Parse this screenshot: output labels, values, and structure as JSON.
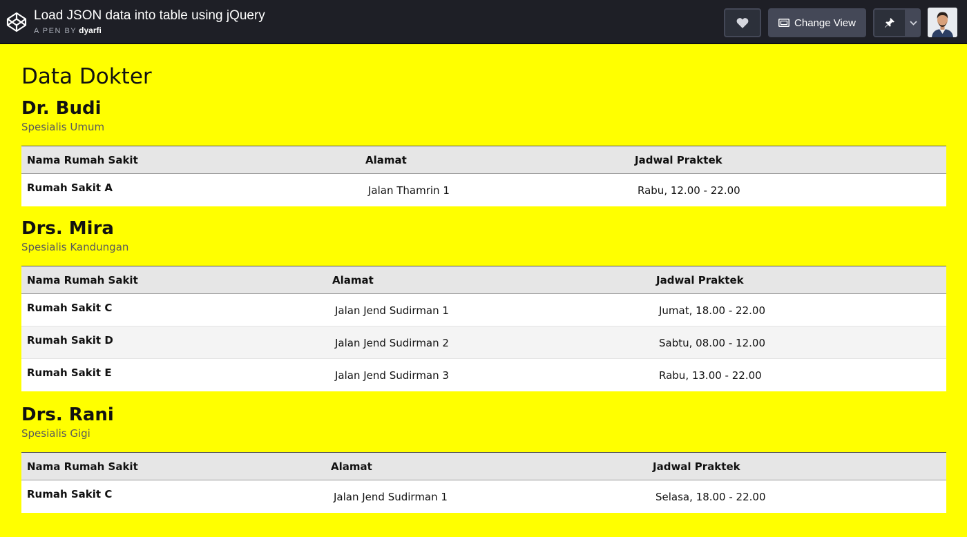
{
  "header": {
    "pen_title": "Load JSON data into table using jQuery",
    "pen_by_label": "A PEN BY",
    "author": "dyarfi",
    "change_view_label": "Change View",
    "like_icon": "heart-icon",
    "pin_icon": "pin-icon",
    "caret_icon": "chevron-down-icon"
  },
  "page": {
    "title": "Data Dokter"
  },
  "table_headers": {
    "hospital": "Nama Rumah Sakit",
    "address": "Alamat",
    "schedule": "Jadwal Praktek"
  },
  "doctors": [
    {
      "name": "Dr. Budi",
      "specialty": "Spesialis Umum",
      "rows": [
        {
          "hospital": "Rumah Sakit A",
          "address": "Jalan Thamrin 1",
          "schedule": "Rabu, 12.00 - 22.00"
        }
      ]
    },
    {
      "name": "Drs. Mira",
      "specialty": "Spesialis Kandungan",
      "rows": [
        {
          "hospital": "Rumah Sakit C",
          "address": "Jalan Jend Sudirman 1",
          "schedule": "Jumat, 18.00 - 22.00"
        },
        {
          "hospital": "Rumah Sakit D",
          "address": "Jalan Jend Sudirman 2",
          "schedule": "Sabtu, 08.00 - 12.00"
        },
        {
          "hospital": "Rumah Sakit E",
          "address": "Jalan Jend Sudirman 3",
          "schedule": "Rabu, 13.00 - 22.00"
        }
      ]
    },
    {
      "name": "Drs. Rani",
      "specialty": "Spesialis Gigi",
      "rows": [
        {
          "hospital": "Rumah Sakit C",
          "address": "Jalan Jend Sudirman 1",
          "schedule": "Selasa, 18.00 - 22.00"
        }
      ]
    }
  ],
  "colors": {
    "page_background": "#ffff00",
    "header_background": "#1e1f26",
    "table_head_background": "#e6e6e6"
  }
}
